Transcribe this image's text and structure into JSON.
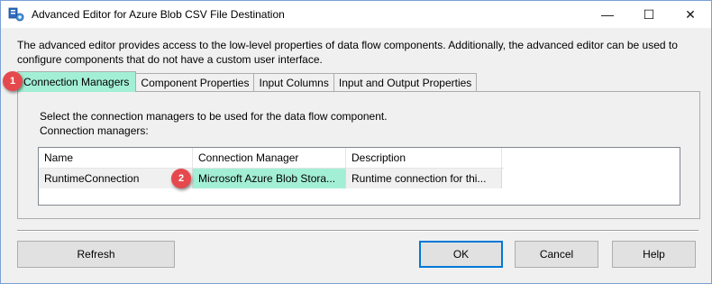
{
  "window": {
    "title": "Advanced Editor for Azure Blob CSV File Destination",
    "minimize_glyph": "—",
    "maximize_glyph": "☐",
    "close_glyph": "✕"
  },
  "description": "The advanced editor provides access to the low-level properties of data flow components. Additionally, the advanced editor can be used to configure components that do not have a custom user interface.",
  "tabs": [
    {
      "label": "Connection Managers",
      "active": true
    },
    {
      "label": "Component Properties",
      "active": false
    },
    {
      "label": "Input Columns",
      "active": false
    },
    {
      "label": "Input and Output Properties",
      "active": false
    }
  ],
  "panel": {
    "instruction": "Select the connection managers to be used for the data flow component.",
    "list_label": "Connection managers:"
  },
  "grid": {
    "columns": [
      "Name",
      "Connection Manager",
      "Description"
    ],
    "rows": [
      [
        "RuntimeConnection",
        "Microsoft Azure Blob Stora...",
        "Runtime connection for thi..."
      ]
    ]
  },
  "markers": [
    "1",
    "2"
  ],
  "buttons": {
    "refresh": "Refresh",
    "ok": "OK",
    "cancel": "Cancel",
    "help": "Help"
  },
  "colors": {
    "highlight": "#a3efd6",
    "marker": "#e5494d",
    "default_button_border": "#0078d7"
  }
}
